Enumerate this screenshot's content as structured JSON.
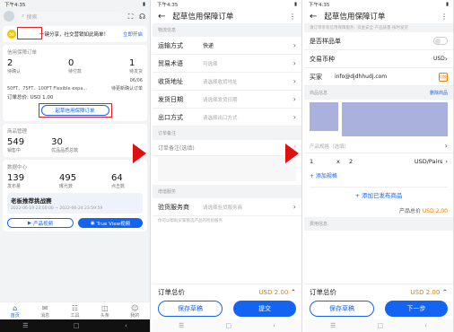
{
  "screen1": {
    "status": {
      "time": "下午4:35",
      "battery": "▮"
    },
    "search_placeholder": "搜索",
    "banner": {
      "coin": "50",
      "text": "一键分享，社交营销如此简单！",
      "link": "立即开启"
    },
    "credit_section": {
      "title": "信用保障订单",
      "stats": [
        {
          "num": "2",
          "label": "待确认"
        },
        {
          "num": "0",
          "label": "待付款"
        },
        {
          "num": "1",
          "label": "待发货"
        }
      ],
      "order_date": "06/06",
      "order_item": "50FT、75FT、100FT Flexible expa...",
      "order_status": "待更新确认订单",
      "order_total": "订单总价: USD 1.00",
      "draft_button": "起草信用保障订单"
    },
    "product_section": {
      "title": "商品管理",
      "stats": [
        {
          "num": "549",
          "label": "销售中"
        },
        {
          "num": "30",
          "label": "优品品质总数"
        }
      ]
    },
    "data_section": {
      "title": "数据中心",
      "stats": [
        {
          "num": "139",
          "label": "发布量"
        },
        {
          "num": "495",
          "label": "曝光数"
        },
        {
          "num": "64",
          "label": "点击数"
        }
      ],
      "promo_title": "老板推荐挑战赛",
      "promo_date": "2022-06-19 23:00:00 ~ 2022-06-24 23:59:59",
      "btn_products": "产品视频",
      "btn_trueview": "True View视频"
    },
    "tabs": [
      {
        "icon": "⌂",
        "label": "首页"
      },
      {
        "icon": "✉",
        "label": "消息"
      },
      {
        "icon": "☷",
        "label": "工具"
      },
      {
        "icon": "◫",
        "label": "头条"
      },
      {
        "icon": "☺",
        "label": "我的"
      }
    ],
    "sysnav": [
      "☰",
      "□",
      "‹"
    ]
  },
  "screen2": {
    "status": {
      "time": "下午4:35"
    },
    "title": "起草信用保障订单",
    "group_logistics": "物流信息",
    "rows": [
      {
        "label": "运输方式",
        "value": "快递",
        "placeholder": ""
      },
      {
        "label": "贸易术语",
        "value": "",
        "placeholder": "可选择"
      },
      {
        "label": "收货地址",
        "value": "",
        "placeholder": "请选择收货地址"
      },
      {
        "label": "发货日期",
        "value": "",
        "placeholder": "请选择发货日期"
      },
      {
        "label": "出口方式",
        "value": "",
        "placeholder": "请选择出口方式"
      }
    ],
    "group_note": "订单备注",
    "note_placeholder": "订单备注(选填)",
    "group_service": "增值服务",
    "inspection": {
      "label": "验货服务商",
      "placeholder": "请选择验货服务商"
    },
    "service_tip": "你可以帮助买家挑选产品的检验服务",
    "total_label": "订单总价",
    "total_amount": "USD 2.00",
    "btn_save": "保存草稿",
    "btn_submit": "提交"
  },
  "screen3": {
    "status": {
      "time": "下午4:35"
    },
    "title": "起草信用保障订单",
    "notice": "请订单享有信用保障服务：·资金安全·产品质量·按时发货",
    "is_sample": "是否样品单",
    "currency_label": "交易币种",
    "currency_value": "USD",
    "buyer_label": "买家",
    "buyer_email": "info@djdhhudj.com",
    "buyer_badge": "切换",
    "product_group": "商品信息",
    "delete_label": "删除商品",
    "spec_label": "产品规格（选填）",
    "qty": {
      "index": "1",
      "mult": "x",
      "count": "2",
      "unit": "USD/Pairs"
    },
    "add_spec": "+ 添加规格",
    "add_product": "+ 添加已发布商品",
    "subtotal_label": "产品总价",
    "subtotal_amount": "USD 2.00",
    "fee_label": "费用信息",
    "total_label": "订单总价",
    "total_amount": "USD 2.00",
    "btn_save": "保存草稿",
    "btn_next": "下一步"
  }
}
